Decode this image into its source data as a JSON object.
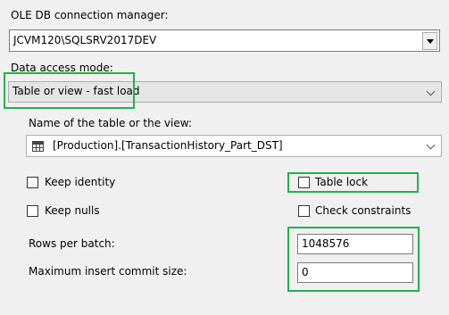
{
  "connection": {
    "label": "OLE DB connection manager:",
    "value": "JCVM120\\SQLSRV2017DEV"
  },
  "access_mode": {
    "label": "Data access mode:",
    "value": "Table or view - fast load"
  },
  "table": {
    "label": "Name of the table or the view:",
    "value": "[Production].[TransactionHistory_Part_DST]"
  },
  "options": {
    "keep_identity": {
      "label": "Keep identity",
      "checked": false
    },
    "table_lock": {
      "label": "Table lock",
      "checked": false
    },
    "keep_nulls": {
      "label": "Keep nulls",
      "checked": false
    },
    "check_constraints": {
      "label": "Check constraints",
      "checked": false
    }
  },
  "batch": {
    "rows_per_batch_label": "Rows per batch:",
    "rows_per_batch_value": "1048576",
    "max_commit_label": "Maximum insert commit size:",
    "max_commit_value": "0"
  },
  "highlight_color": "#22b14c"
}
